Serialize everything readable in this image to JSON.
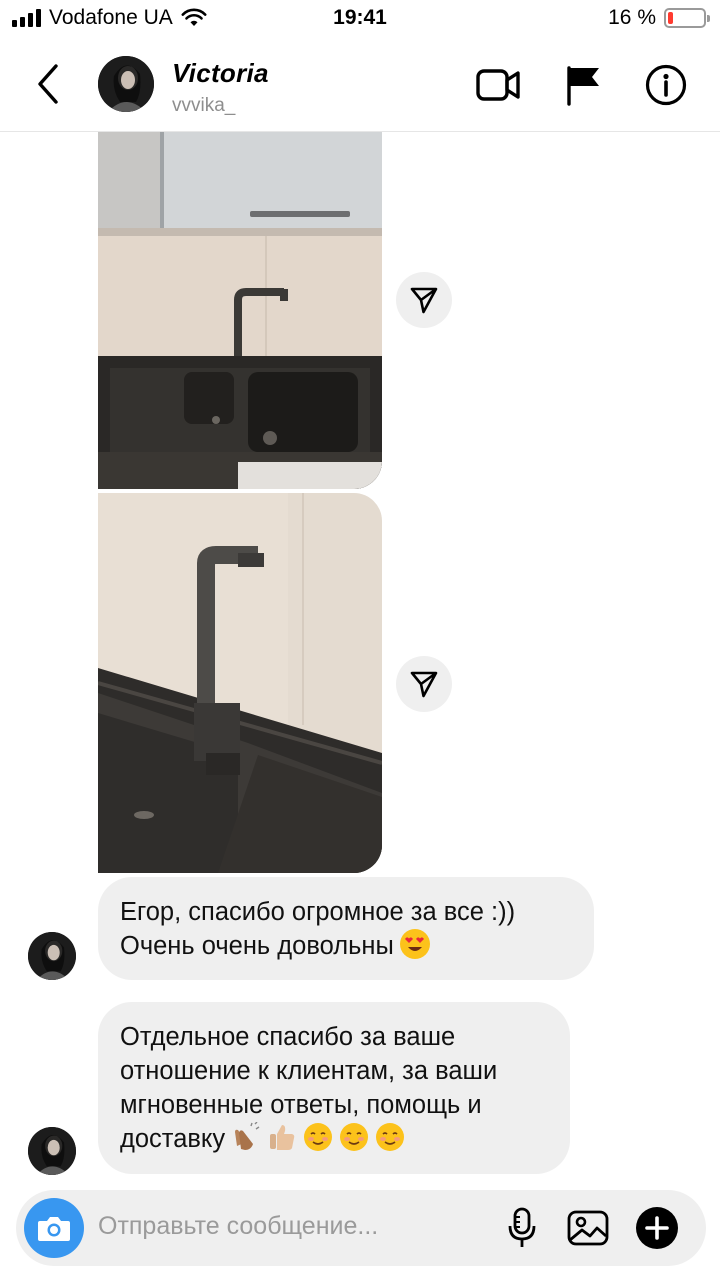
{
  "status_bar": {
    "carrier": "Vodafone UA",
    "time": "19:41",
    "battery_percent": "16 %",
    "battery_level": 0.16,
    "icons": [
      "signal-icon",
      "wifi-icon",
      "battery-icon"
    ]
  },
  "header": {
    "name": "Victoria",
    "username": "vvvika_",
    "icons": [
      "back-chevron-icon",
      "video-call-icon",
      "flag-icon",
      "info-icon"
    ]
  },
  "messages": [
    {
      "type": "photo",
      "description_icon": "sink-photo"
    },
    {
      "type": "photo",
      "description_icon": "faucet-photo"
    },
    {
      "type": "text",
      "lines": [
        "Егор, спасибо огромное за все :))",
        "Очень очень довольны"
      ],
      "emoji": [
        "heart-eyes-emoji"
      ]
    },
    {
      "type": "text",
      "lines": [
        "Отдельное спасибо за ваше",
        "отношение к клиентам, за ваши",
        "мгновенные ответы, помощь и",
        "доставку"
      ],
      "emoji": [
        "clapping-hands-emoji",
        "thumbs-up-emoji",
        "smiling-face-emoji",
        "smiling-face-emoji",
        "smiling-face-emoji"
      ]
    }
  ],
  "composer": {
    "placeholder": "Отправьте сообщение...",
    "icons": [
      "camera-icon",
      "microphone-icon",
      "gallery-icon",
      "plus-icon"
    ]
  },
  "colors": {
    "accent": "#3897f0",
    "bubble": "#efefef",
    "battery_low": "#ff3b30",
    "secondary_text": "#8e8e8e"
  }
}
